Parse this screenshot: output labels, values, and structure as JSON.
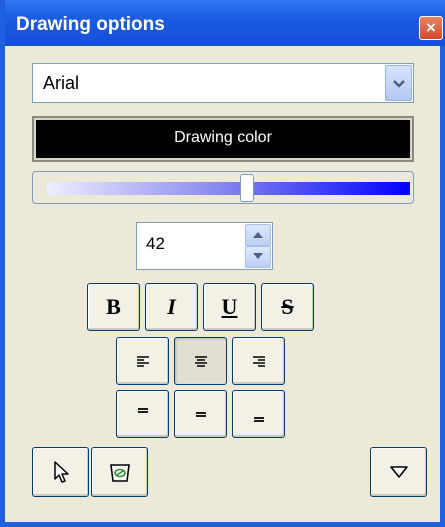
{
  "window": {
    "title": "Drawing options",
    "close_glyph": "×"
  },
  "font_select": {
    "value": "Arial"
  },
  "color_button": {
    "label": "Drawing color",
    "color": "#000000"
  },
  "size_slider": {
    "level": 0.55,
    "gradient_start": "#eeeeff",
    "gradient_end": "#0000ff"
  },
  "font_size": {
    "value": "42"
  },
  "style_buttons": [
    {
      "name": "bold",
      "glyph": "B"
    },
    {
      "name": "italic",
      "glyph": "I"
    },
    {
      "name": "underline",
      "glyph": "U"
    },
    {
      "name": "strikethrough",
      "glyph": "S"
    }
  ],
  "align_buttons": [
    {
      "name": "align-left",
      "glyph": "≡",
      "pressed": false
    },
    {
      "name": "align-center",
      "glyph": "≡",
      "pressed": true
    },
    {
      "name": "align-right",
      "glyph": "≡",
      "pressed": false
    }
  ],
  "valign_buttons": [
    {
      "name": "valign-top",
      "glyph": "═"
    },
    {
      "name": "valign-middle",
      "glyph": "═"
    },
    {
      "name": "valign-bottom",
      "glyph": "═"
    }
  ],
  "tools": [
    {
      "name": "select-pointer",
      "icon": "cursor-arrow-icon"
    },
    {
      "name": "eraser",
      "icon": "eraser-icon"
    },
    {
      "name": "more-options",
      "icon": "triangle-down-icon"
    }
  ]
}
